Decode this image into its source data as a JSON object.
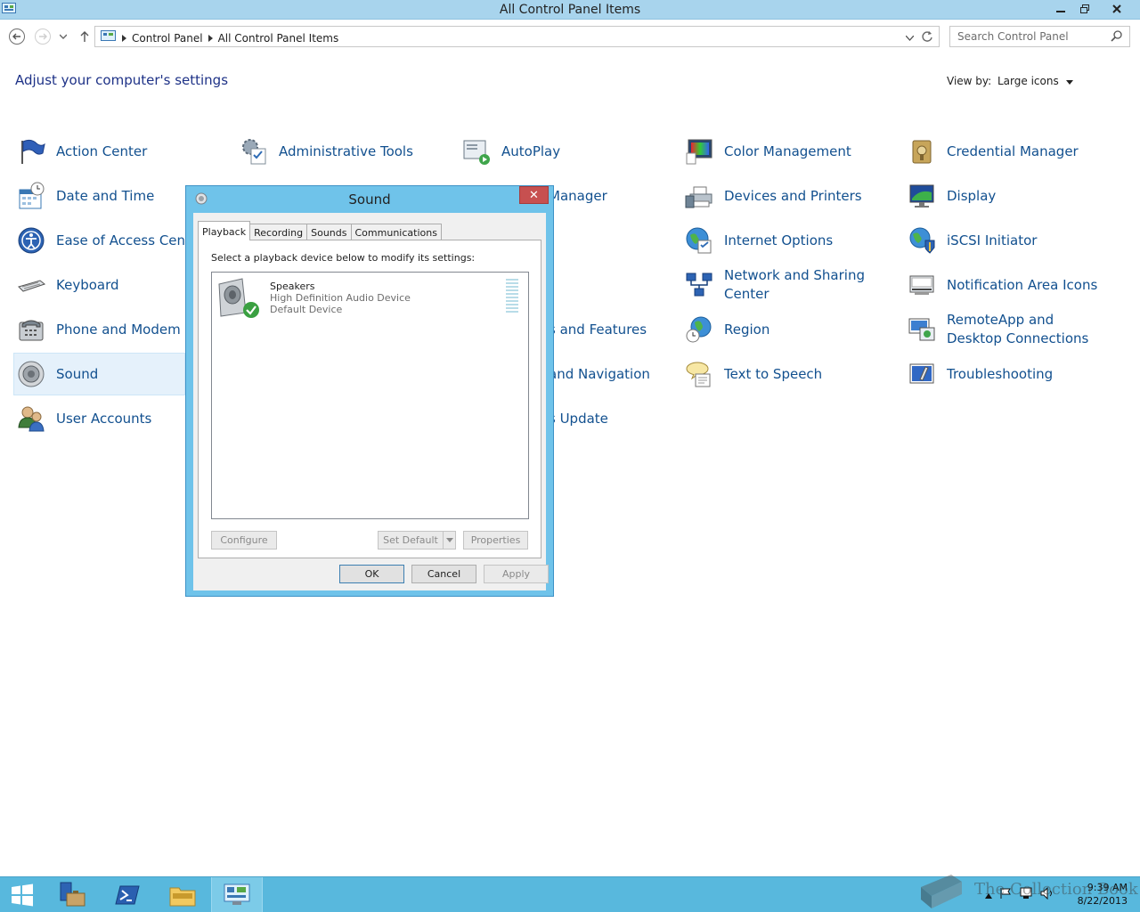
{
  "window": {
    "title": "All Control Panel Items"
  },
  "address": {
    "crumbs": [
      "Control Panel",
      "All Control Panel Items"
    ]
  },
  "search": {
    "placeholder": "Search Control Panel"
  },
  "page": {
    "heading": "Adjust your computer's settings",
    "view_by_label": "View by:",
    "view_by_value": "Large icons"
  },
  "items": [
    {
      "label": "Action Center",
      "icon": "flag-icon"
    },
    {
      "label": "Administrative Tools",
      "icon": "admin-tools-icon"
    },
    {
      "label": "AutoPlay",
      "icon": "autoplay-icon"
    },
    {
      "label": "Color Management",
      "icon": "color-management-icon"
    },
    {
      "label": "Credential Manager",
      "icon": "credential-manager-icon"
    },
    {
      "label": "Date and Time",
      "icon": "calendar-clock-icon"
    },
    {
      "label": "Manager",
      "icon": "device-manager-icon"
    },
    {
      "label": "Devices and Printers",
      "icon": "printer-icon"
    },
    {
      "label": "Display",
      "icon": "monitor-icon"
    },
    {
      "label": "Ease of Access Center",
      "icon": "ease-of-access-icon"
    },
    {
      "label": "Internet Options",
      "icon": "globe-icon"
    },
    {
      "label": "iSCSI Initiator",
      "icon": "iscsi-icon"
    },
    {
      "label": "Keyboard",
      "icon": "keyboard-icon"
    },
    {
      "label": "Network and Sharing Center",
      "icon": "network-icon"
    },
    {
      "label": "Notification Area Icons",
      "icon": "notification-area-icon"
    },
    {
      "label": "Phone and Modem",
      "icon": "phone-icon"
    },
    {
      "label": "s and Features",
      "icon": "programs-icon"
    },
    {
      "label": "Region",
      "icon": "region-icon"
    },
    {
      "label": "RemoteApp and Desktop Connections",
      "icon": "remoteapp-icon"
    },
    {
      "label": "Sound",
      "icon": "speaker-icon"
    },
    {
      "label": "and Navigation",
      "icon": "taskbar-icon"
    },
    {
      "label": "Text to Speech",
      "icon": "speech-bubble-icon"
    },
    {
      "label": "Troubleshooting",
      "icon": "troubleshooting-icon"
    },
    {
      "label": "User Accounts",
      "icon": "users-icon"
    },
    {
      "label": "s Update",
      "icon": "windows-update-icon"
    }
  ],
  "dialog": {
    "title": "Sound",
    "close": "✕",
    "tabs": [
      "Playback",
      "Recording",
      "Sounds",
      "Communications"
    ],
    "instruction": "Select a playback device below to modify its settings:",
    "device": {
      "name": "Speakers",
      "driver": "High Definition Audio Device",
      "status": "Default Device"
    },
    "buttons": {
      "configure": "Configure",
      "set_default": "Set Default",
      "properties": "Properties",
      "ok": "OK",
      "cancel": "Cancel",
      "apply": "Apply"
    }
  },
  "taskbar": {
    "time": "9:39 AM",
    "date": "8/22/2013"
  },
  "watermark": "The Collection Book",
  "colors": {
    "link": "#12508f",
    "heading": "#1e3287",
    "titlebar": "#a8d4ed",
    "dialog_frame": "#6fc3ea",
    "taskbar": "#58b8dd"
  }
}
